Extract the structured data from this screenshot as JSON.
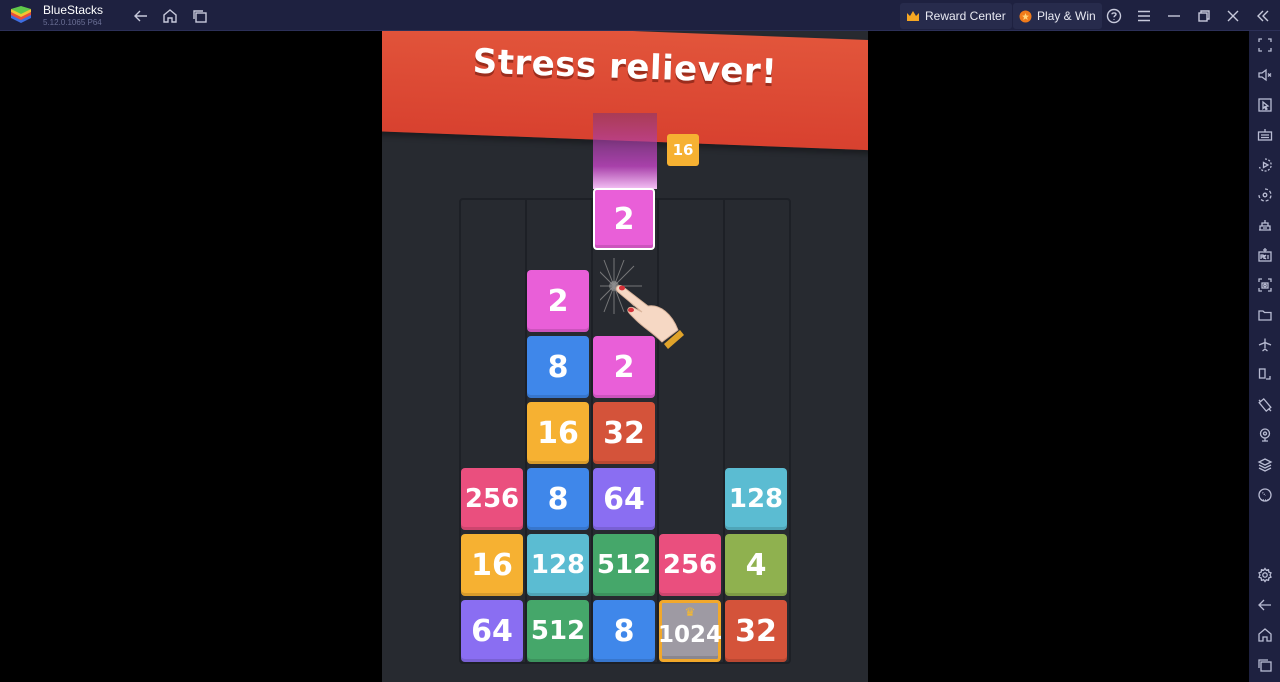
{
  "titlebar": {
    "app_name": "BlueStacks",
    "version": "5.12.0.1065  P64",
    "nav_icons": [
      "back-icon",
      "home-icon",
      "recent-apps-icon"
    ],
    "reward_center_label": "Reward Center",
    "play_win_label": "Play & Win",
    "window_icons": [
      "help-icon",
      "menu-icon",
      "minimize-icon",
      "restore-icon",
      "close-icon",
      "collapse-sidebar-icon"
    ]
  },
  "sidebar": {
    "items": [
      {
        "name": "fullscreen-icon",
        "label": "Fullscreen"
      },
      {
        "name": "volume-mute-icon",
        "label": "Volume"
      },
      {
        "name": "pointer-icon",
        "label": "Game controls"
      },
      {
        "name": "keyboard-icon",
        "label": "Keyboard"
      },
      {
        "name": "macro-icon",
        "label": "Record"
      },
      {
        "name": "rotate-icon",
        "label": "Sync"
      },
      {
        "name": "multi-instance-icon",
        "label": "Multi-instance"
      },
      {
        "name": "apk-install-icon",
        "label": "Install APK"
      },
      {
        "name": "screenshot-icon",
        "label": "Screenshot"
      },
      {
        "name": "folder-icon",
        "label": "Media folder"
      },
      {
        "name": "airplane-icon",
        "label": "Airplane mode"
      },
      {
        "name": "rotate-screen-icon",
        "label": "Rotate"
      },
      {
        "name": "shake-icon",
        "label": "Shake"
      },
      {
        "name": "location-icon",
        "label": "Location"
      },
      {
        "name": "layers-icon",
        "label": "Layers"
      },
      {
        "name": "performance-icon",
        "label": "Performance"
      },
      {
        "name": "settings-icon",
        "label": "Settings"
      },
      {
        "name": "back-icon",
        "label": "Back"
      },
      {
        "name": "home-icon",
        "label": "Home"
      },
      {
        "name": "recent-apps-icon",
        "label": "Recent apps"
      }
    ]
  },
  "game": {
    "banner": "Stress reliever!",
    "next_tile": "16",
    "falling_tile": {
      "value": "2",
      "column": 2
    },
    "columns": 5,
    "tiles": [
      {
        "value": "2",
        "col": 1,
        "row": 5,
        "color": "#e95fd8"
      },
      {
        "value": "8",
        "col": 1,
        "row": 4,
        "color": "#3f87ea"
      },
      {
        "value": "2",
        "col": 2,
        "row": 4,
        "color": "#e95fd8"
      },
      {
        "value": "16",
        "col": 1,
        "row": 3,
        "color": "#f6b132"
      },
      {
        "value": "32",
        "col": 2,
        "row": 3,
        "color": "#d4533a"
      },
      {
        "value": "256",
        "col": 0,
        "row": 2,
        "color": "#ea4f7e"
      },
      {
        "value": "8",
        "col": 1,
        "row": 2,
        "color": "#3f87ea"
      },
      {
        "value": "64",
        "col": 2,
        "row": 2,
        "color": "#8a6ef2"
      },
      {
        "value": "128",
        "col": 4,
        "row": 2,
        "color": "#5bbcd2"
      },
      {
        "value": "16",
        "col": 0,
        "row": 1,
        "color": "#f6b132"
      },
      {
        "value": "128",
        "col": 1,
        "row": 1,
        "color": "#5bbcd2"
      },
      {
        "value": "512",
        "col": 2,
        "row": 1,
        "color": "#45a76a"
      },
      {
        "value": "256",
        "col": 3,
        "row": 1,
        "color": "#ea4f7e"
      },
      {
        "value": "4",
        "col": 4,
        "row": 1,
        "color": "#8fb14f"
      },
      {
        "value": "64",
        "col": 0,
        "row": 0,
        "color": "#8a6ef2"
      },
      {
        "value": "512",
        "col": 1,
        "row": 0,
        "color": "#45a76a"
      },
      {
        "value": "8",
        "col": 2,
        "row": 0,
        "color": "#3f87ea"
      },
      {
        "value": "1024",
        "col": 3,
        "row": 0,
        "color": "#9e9aa3",
        "crown": true
      },
      {
        "value": "32",
        "col": 4,
        "row": 0,
        "color": "#d4533a"
      }
    ]
  }
}
